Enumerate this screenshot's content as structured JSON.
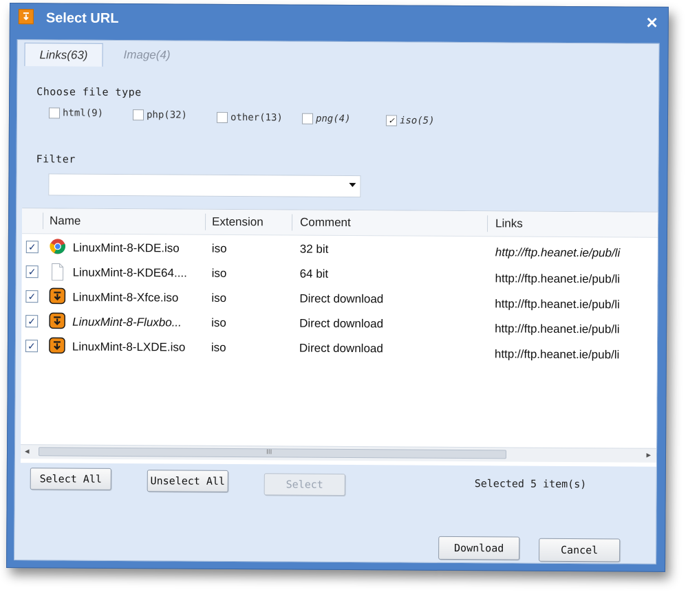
{
  "window": {
    "title": "Select URL",
    "close_glyph": "✕",
    "app_icon": "download-arrow-icon"
  },
  "tabs": [
    {
      "label": "Links(63)",
      "active": true
    },
    {
      "label": "Image(4)",
      "active": false
    }
  ],
  "file_type": {
    "heading": "Choose file type",
    "options": [
      {
        "label": "html(9)",
        "checked": false
      },
      {
        "label": "php(32)",
        "checked": false
      },
      {
        "label": "other(13)",
        "checked": false
      },
      {
        "label": "png(4)",
        "checked": false
      },
      {
        "label": "iso(5)",
        "checked": true
      }
    ]
  },
  "filter": {
    "label": "Filter",
    "value": ""
  },
  "table": {
    "columns": [
      "Name",
      "Extension",
      "Comment",
      "Links"
    ],
    "rows": [
      {
        "checked": true,
        "icon": "chrome-icon",
        "name": "LinuxMint-8-KDE.iso",
        "ext": "iso",
        "comment": "32 bit",
        "link": "http://ftp.heanet.ie/pub/li"
      },
      {
        "checked": true,
        "icon": "file-icon",
        "name": "LinuxMint-8-KDE64....",
        "ext": "iso",
        "comment": "64 bit",
        "link": "http://ftp.heanet.ie/pub/li"
      },
      {
        "checked": true,
        "icon": "download-app-icon",
        "name": "LinuxMint-8-Xfce.iso",
        "ext": "iso",
        "comment": "Direct download",
        "link": "http://ftp.heanet.ie/pub/li"
      },
      {
        "checked": true,
        "icon": "download-app-icon",
        "name": "LinuxMint-8-Fluxbo...",
        "ext": "iso",
        "comment": "Direct download",
        "link": "http://ftp.heanet.ie/pub/li"
      },
      {
        "checked": true,
        "icon": "download-app-icon",
        "name": "LinuxMint-8-LXDE.iso",
        "ext": "iso",
        "comment": "Direct download",
        "link": "http://ftp.heanet.ie/pub/li"
      }
    ]
  },
  "scrollbar": {
    "left_glyph": "◂",
    "right_glyph": "▸",
    "grip_glyph": "III"
  },
  "buttons": {
    "select_all": "Select All",
    "unselect_all": "Unselect All",
    "select": "Select",
    "download": "Download",
    "cancel": "Cancel"
  },
  "status": "Selected 5 item(s)",
  "colors": {
    "title_bar": "#4e82c8",
    "client_bg": "#dde8f7",
    "icon_orange": "#f08a12"
  }
}
